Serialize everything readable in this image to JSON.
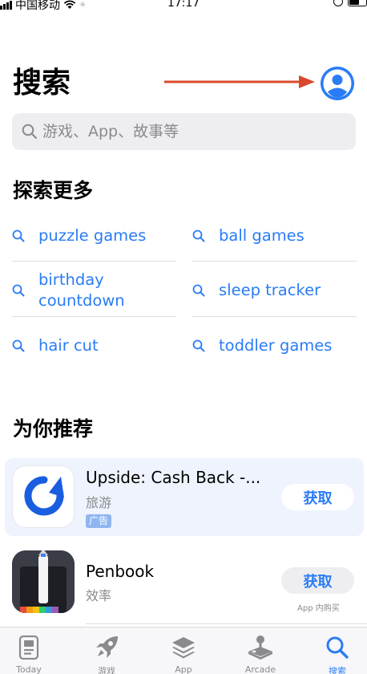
{
  "status_bar": {
    "carrier": "中国移动",
    "time": "17:17"
  },
  "header": {
    "title": "搜索",
    "account_icon": "person-circle-icon"
  },
  "search": {
    "placeholder": "游戏、App、故事等",
    "value": ""
  },
  "discover": {
    "heading": "探索更多",
    "items": [
      {
        "label": "puzzle games"
      },
      {
        "label": "ball games"
      },
      {
        "label": "birthday countdown",
        "line1": "birthday",
        "line2": "countdown"
      },
      {
        "label": "sleep tracker"
      },
      {
        "label": "hair cut"
      },
      {
        "label": "toddler games"
      }
    ]
  },
  "recommendations": {
    "heading": "为你推荐",
    "apps": [
      {
        "name": "Upside: Cash Back -...",
        "category": "旅游",
        "badge": "广告",
        "button": "获取"
      },
      {
        "name": "Penbook",
        "category": "效率",
        "button": "获取",
        "note": "App 内购买"
      }
    ]
  },
  "tab_bar": {
    "items": [
      {
        "label": "Today",
        "icon": "today-icon"
      },
      {
        "label": "游戏",
        "icon": "rocket-icon"
      },
      {
        "label": "App",
        "icon": "stack-icon"
      },
      {
        "label": "Arcade",
        "icon": "joystick-icon"
      },
      {
        "label": "搜索",
        "icon": "search-icon",
        "active": true
      }
    ]
  },
  "colors": {
    "accent": "#2a7cf6",
    "annotation_arrow": "#d9482b",
    "ad_background": "#eef3fd"
  }
}
